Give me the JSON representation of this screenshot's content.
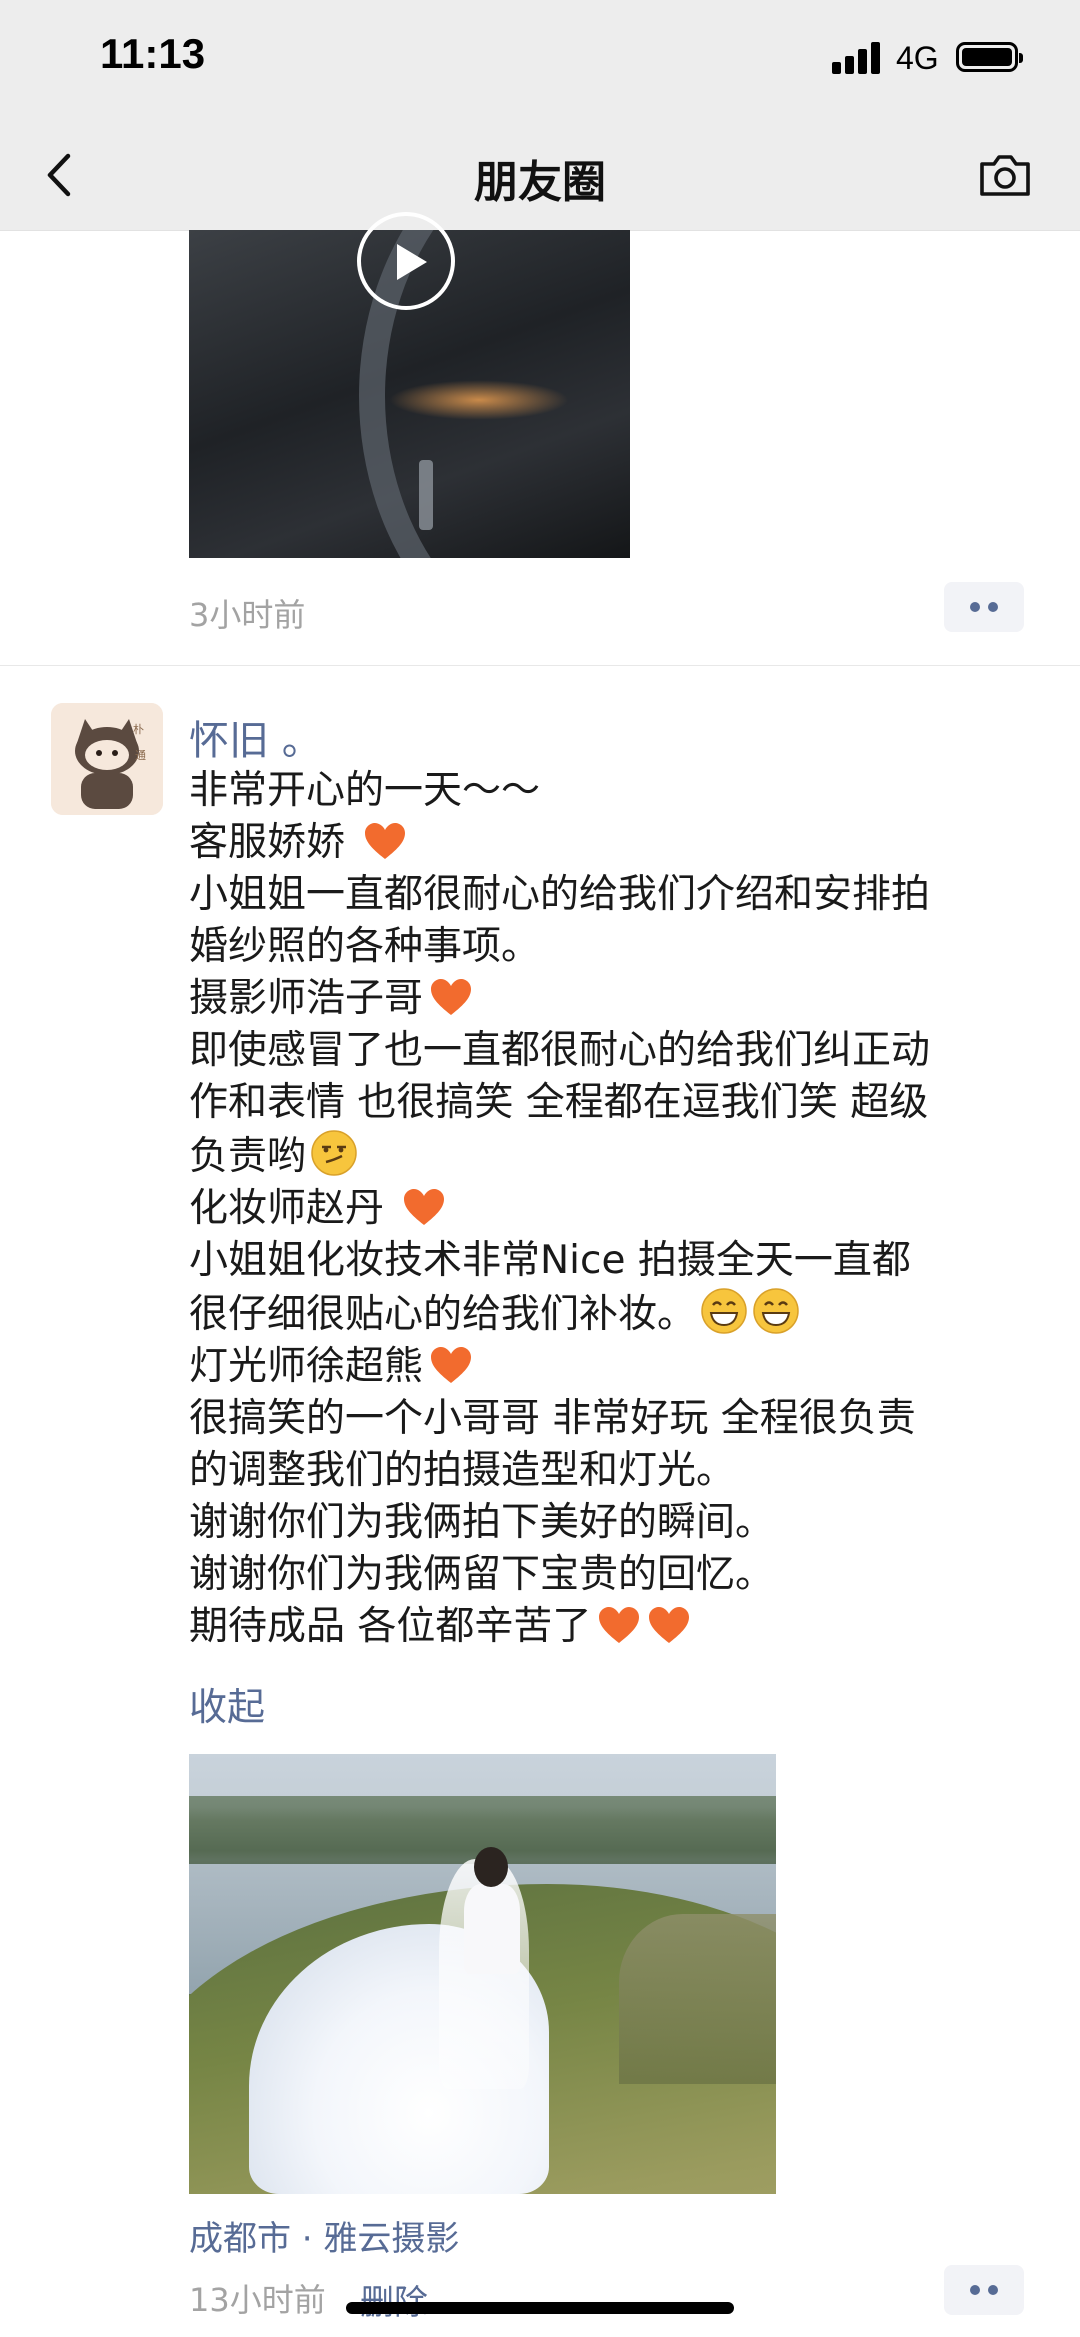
{
  "status_bar": {
    "time": "11:13",
    "network": "4G",
    "icons": [
      "signal-icon",
      "battery-icon"
    ]
  },
  "nav": {
    "title": "朋友圈",
    "back_icon": "chevron-left-icon",
    "camera_icon": "camera-icon"
  },
  "previous_post": {
    "media_type": "video",
    "time_ago": "3小时前"
  },
  "post": {
    "username": "怀旧 。",
    "lines": [
      {
        "text": "非常开心的一天～～",
        "suffix": []
      },
      {
        "text": "客服娇娇 ",
        "suffix": [
          "heart"
        ]
      },
      {
        "text": "小姐姐一直都很耐心的给我们介绍和安排拍",
        "suffix": []
      },
      {
        "text": "婚纱照的各种事项。",
        "suffix": []
      },
      {
        "text": "摄影师浩子哥",
        "suffix": [
          "heart"
        ]
      },
      {
        "text": "即使感冒了也一直都很耐心的给我们纠正动",
        "suffix": []
      },
      {
        "text": "作和表情  也很搞笑  全程都在逗我们笑  超级",
        "suffix": []
      },
      {
        "text": "负责哟",
        "suffix": [
          "smirk"
        ]
      },
      {
        "text": "化妆师赵丹 ",
        "suffix": [
          "heart"
        ]
      },
      {
        "text": "小姐姐化妆技术非常Nice   拍摄全天一直都",
        "suffix": []
      },
      {
        "text": "很仔细很贴心的给我们补妆。",
        "suffix": [
          "grin",
          "grin"
        ]
      },
      {
        "text": "灯光师徐超熊",
        "suffix": [
          "heart"
        ]
      },
      {
        "text": "很搞笑的一个小哥哥  非常好玩   全程很负责",
        "suffix": []
      },
      {
        "text": "的调整我们的拍摄造型和灯光。",
        "suffix": []
      },
      {
        "text": "谢谢你们为我俩拍下美好的瞬间。",
        "suffix": []
      },
      {
        "text": "谢谢你们为我俩留下宝贵的回忆。",
        "suffix": []
      },
      {
        "text": "期待成品   各位都辛苦了",
        "suffix": [
          "heart",
          "heart"
        ]
      }
    ],
    "collapse_label": "收起",
    "location": "成都市 · 雅云摄影",
    "time_ago": "13小时前",
    "delete_label": "删除"
  },
  "colors": {
    "link": "#576b95",
    "bar_bg": "#ededed",
    "heart": "#f26b2e",
    "muted": "#a3a3a3"
  }
}
